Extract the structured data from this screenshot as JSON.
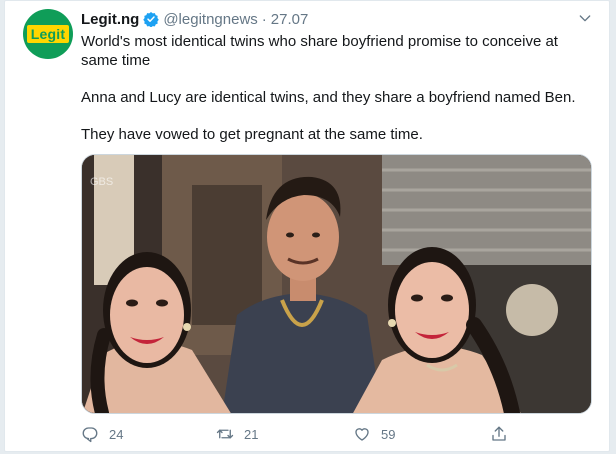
{
  "tweet": {
    "author_name": "Legit.ng",
    "handle": "@legitngnews",
    "separator": "·",
    "date": "27.07",
    "avatar_text": "Legit",
    "paragraphs": [
      "World's most identical twins who share boyfriend promise to conceive at same time",
      "Anna and Lucy are identical twins, and they share a boyfriend named Ben.",
      "They have vowed to get pregnant at the same time."
    ],
    "photo_watermark": "GBS",
    "stats": {
      "replies": "24",
      "retweets": "21",
      "likes": "59"
    }
  },
  "colors": {
    "text": "#14171a",
    "secondary": "#657786",
    "verified": "#1da1f2",
    "brand_green": "#0f9d58",
    "brand_yellow": "#ffd600"
  },
  "icons": [
    "verified-badge-icon",
    "chevron-down-icon",
    "reply-icon",
    "retweet-icon",
    "like-icon",
    "share-icon"
  ]
}
